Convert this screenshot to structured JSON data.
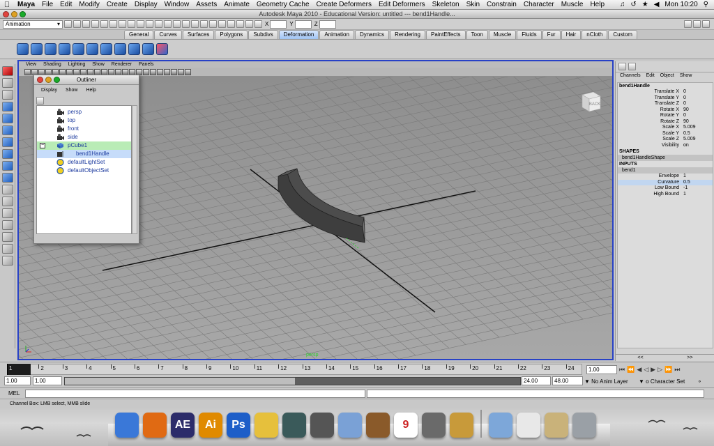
{
  "menubar": {
    "app": "Maya",
    "items": [
      "File",
      "Edit",
      "Modify",
      "Create",
      "Display",
      "Window",
      "Assets",
      "Animate",
      "Geometry Cache",
      "Create Deformers",
      "Edit Deformers",
      "Skeleton",
      "Skin",
      "Constrain",
      "Character",
      "Muscle",
      "Help"
    ],
    "clock": "Mon 10:20"
  },
  "window": {
    "title": "Autodesk Maya 2010 - Educational Version: untitled   ---   bend1Handle..."
  },
  "statusline": {
    "menuset": "Animation",
    "x_label": "X",
    "y_label": "Y",
    "z_label": "Z"
  },
  "shelf": {
    "tabs": [
      "General",
      "Curves",
      "Surfaces",
      "Polygons",
      "Subdivs",
      "Deformation",
      "Animation",
      "Dynamics",
      "Rendering",
      "PaintEffects",
      "Toon",
      "Muscle",
      "Fluids",
      "Fur",
      "Hair",
      "nCloth",
      "Custom"
    ],
    "active_tab": "Deformation"
  },
  "viewport": {
    "menu": [
      "View",
      "Shading",
      "Lighting",
      "Show",
      "Renderer",
      "Panels"
    ],
    "camera_label": "persp",
    "viewcube_label": "BACK"
  },
  "outliner": {
    "title": "Outliner",
    "menu": [
      "Display",
      "Show",
      "Help"
    ],
    "items": [
      {
        "label": "persp",
        "icon": "camera-icon"
      },
      {
        "label": "top",
        "icon": "camera-icon"
      },
      {
        "label": "front",
        "icon": "camera-icon"
      },
      {
        "label": "side",
        "icon": "camera-icon"
      },
      {
        "label": "pCube1",
        "icon": "mesh-icon",
        "expand": "−"
      },
      {
        "label": "bend1Handle",
        "icon": "deformer-handle-icon"
      },
      {
        "label": "defaultLightSet",
        "icon": "set-icon"
      },
      {
        "label": "defaultObjectSet",
        "icon": "set-icon"
      }
    ]
  },
  "channelbox": {
    "menu": [
      "Channels",
      "Edit",
      "Object",
      "Show"
    ],
    "node": "bend1Handle",
    "attrs": [
      {
        "name": "Translate X",
        "value": "0"
      },
      {
        "name": "Translate Y",
        "value": "0"
      },
      {
        "name": "Translate Z",
        "value": "0"
      },
      {
        "name": "Rotate X",
        "value": "90"
      },
      {
        "name": "Rotate Y",
        "value": "0"
      },
      {
        "name": "Rotate Z",
        "value": "90"
      },
      {
        "name": "Scale X",
        "value": "5.009"
      },
      {
        "name": "Scale Y",
        "value": "0.5"
      },
      {
        "name": "Scale Z",
        "value": "5.009"
      },
      {
        "name": "Visibility",
        "value": "on"
      }
    ],
    "shapes_label": "SHAPES",
    "shape_node": "bend1HandleShape",
    "inputs_label": "INPUTS",
    "input_node": "bend1",
    "input_attrs": [
      {
        "name": "Envelope",
        "value": "1"
      },
      {
        "name": "Curvature",
        "value": "0.5"
      },
      {
        "name": "Low Bound",
        "value": "-1"
      },
      {
        "name": "High Bound",
        "value": "1"
      }
    ],
    "footer_left": "<<",
    "footer_right": ">>"
  },
  "timeslider": {
    "current_frame": "1",
    "ticks": [
      "1",
      "2",
      "3",
      "4",
      "5",
      "6",
      "7",
      "8",
      "9",
      "10",
      "11",
      "12",
      "13",
      "14",
      "15",
      "16",
      "17",
      "18",
      "19",
      "20",
      "21",
      "22",
      "23",
      "24"
    ],
    "current_field": "1.00"
  },
  "rangeslider": {
    "start": "1.00",
    "start_inner": "1.00",
    "end_inner": "24.00",
    "end": "48.00",
    "anim_layer": "No Anim Layer",
    "character_set": "o Character Set"
  },
  "mel": {
    "label": "MEL"
  },
  "helpline": {
    "text": "Channel Box: LMB select, MMB slide"
  },
  "dock": {
    "items": [
      {
        "name": "finder-dock-icon",
        "label": "",
        "color": "#3a78d8"
      },
      {
        "name": "firefox-dock-icon",
        "label": "",
        "color": "#e06a13"
      },
      {
        "name": "after-effects-dock-icon",
        "label": "AE",
        "color": "#2c2c6a"
      },
      {
        "name": "illustrator-dock-icon",
        "label": "Ai",
        "color": "#e08a00"
      },
      {
        "name": "photoshop-dock-icon",
        "label": "Ps",
        "color": "#1d5ec8"
      },
      {
        "name": "pencil-dock-icon",
        "label": "",
        "color": "#e6c03c"
      },
      {
        "name": "maya-dock-icon",
        "label": "",
        "color": "#3a5a5a"
      },
      {
        "name": "camera-dock-icon",
        "label": "",
        "color": "#555555"
      },
      {
        "name": "iphoto-dock-icon",
        "label": "",
        "color": "#7aa1d6"
      },
      {
        "name": "garageband-dock-icon",
        "label": "",
        "color": "#8a5a2a"
      },
      {
        "name": "ical-dock-icon",
        "label": "9",
        "color": "#ffffff"
      },
      {
        "name": "system-prefs-dock-icon",
        "label": "",
        "color": "#6a6a6a"
      },
      {
        "name": "keychain-dock-icon",
        "label": "",
        "color": "#c89a3a"
      },
      {
        "name": "folder-dock-icon",
        "label": "",
        "color": "#7da7d9"
      },
      {
        "name": "document-dock-icon",
        "label": "",
        "color": "#e8e8e8"
      },
      {
        "name": "stamp-dock-icon",
        "label": "",
        "color": "#c9b27a"
      },
      {
        "name": "trash-dock-icon",
        "label": "",
        "color": "#9aa0a6"
      }
    ]
  }
}
